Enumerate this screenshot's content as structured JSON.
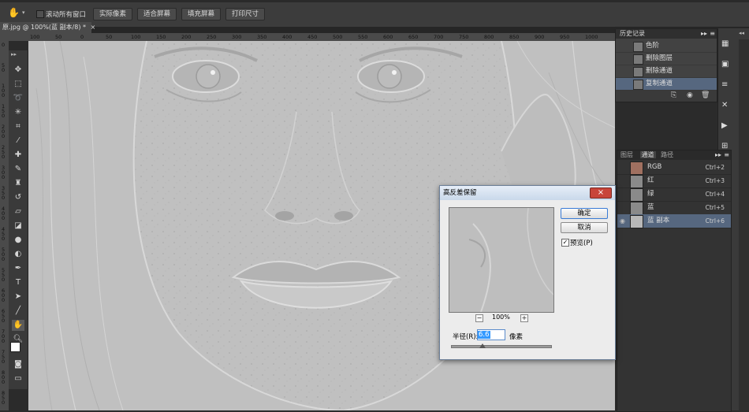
{
  "optbar": {
    "scroll_all_label": "滚动所有窗口",
    "buttons": [
      "实际像素",
      "适合屏幕",
      "填充屏幕",
      "打印尺寸"
    ]
  },
  "document_tab": {
    "title": "原.jpg @ 100%(蓝 副本/8) *",
    "close": "×"
  },
  "ruler": {
    "h_labels": [
      "100",
      "50",
      "0",
      "50",
      "100",
      "150",
      "200",
      "250",
      "300",
      "350",
      "400",
      "450",
      "500",
      "550",
      "600",
      "650",
      "700",
      "750",
      "800",
      "850",
      "900",
      "950",
      "1000"
    ],
    "v_labels": [
      "0",
      "5 0",
      "1 0 0",
      "1 5 0",
      "2 0 0",
      "2 5 0",
      "3 0 0",
      "3 5 0",
      "4 0 0",
      "4 5 0",
      "5 0 0",
      "5 5 0",
      "6 0 0",
      "6 5 0",
      "7 0 0",
      "7 5 0",
      "8 0 0",
      "8 5 0"
    ]
  },
  "history_panel": {
    "tab": "历史记录",
    "items": [
      {
        "label": "色阶"
      },
      {
        "label": "删除图层"
      },
      {
        "label": "删除通道"
      },
      {
        "label": "复制通道"
      }
    ]
  },
  "channels_panel": {
    "tabs": [
      "图层",
      "通道",
      "路径"
    ],
    "rows": [
      {
        "name": "RGB",
        "shortcut": "Ctrl+2"
      },
      {
        "name": "红",
        "shortcut": "Ctrl+3"
      },
      {
        "name": "绿",
        "shortcut": "Ctrl+4"
      },
      {
        "name": "蓝",
        "shortcut": "Ctrl+5"
      },
      {
        "name": "蓝 副本",
        "shortcut": "Ctrl+6"
      }
    ]
  },
  "dialog": {
    "title": "高反差保留",
    "ok": "确定",
    "cancel": "取消",
    "preview_label": "预览(P)",
    "preview_checked": true,
    "zoom": "100%",
    "zoom_minus": "−",
    "zoom_plus": "+",
    "radius_label": "半径(R):",
    "radius_value": "6.6",
    "unit": "像素",
    "close": "×"
  },
  "colors": {
    "panel_bg": "#333333",
    "selected_row": "#56677f",
    "dialog_bg": "#ececec",
    "canvas_gray": "#c1c1c1",
    "title_gradient": "#c9d8ea"
  }
}
